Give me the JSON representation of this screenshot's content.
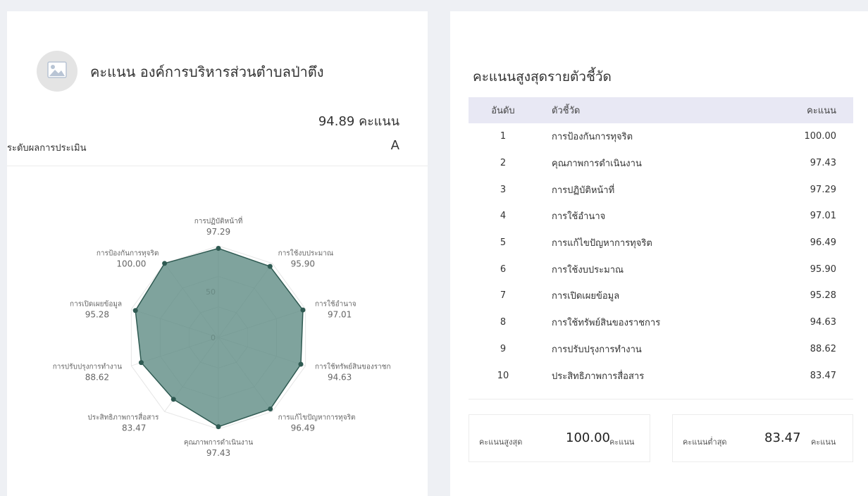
{
  "summary": {
    "title": "คะแนน องค์การบริหารส่วนตำบลป่าตึง",
    "score": "94.89",
    "score_unit": "คะแนน",
    "level_label": "ระดับผลการประเมิน",
    "level_value": "A"
  },
  "chart_data": {
    "type": "radar",
    "scale_ticks": [
      "0",
      "50"
    ],
    "rmax": 100,
    "fill_color": "#5f8c84",
    "axes": [
      {
        "label": "การปฏิบัติหน้าที่",
        "value": 97.29,
        "value_label": "97.29"
      },
      {
        "label": "การใช้งบประมาณ",
        "value": 95.9,
        "value_label": "95.90"
      },
      {
        "label": "การใช้อำนาจ",
        "value": 97.01,
        "value_label": "97.01"
      },
      {
        "label": "การใช้ทรัพย์สินของราชก",
        "value": 94.63,
        "value_label": "94.63"
      },
      {
        "label": "การแก้ไขปัญหาการทุจริต",
        "value": 96.49,
        "value_label": "96.49"
      },
      {
        "label": "คุณภาพการดำเนินงาน",
        "value": 97.43,
        "value_label": "97.43"
      },
      {
        "label": "ประสิทธิภาพการสื่อสาร",
        "value": 83.47,
        "value_label": "83.47"
      },
      {
        "label": "การปรับปรุงการทำงาน",
        "value": 88.62,
        "value_label": "88.62"
      },
      {
        "label": "การเปิดเผยข้อมูล",
        "value": 95.28,
        "value_label": "95.28"
      },
      {
        "label": "การป้องกันการทุจริต",
        "value": 100.0,
        "value_label": "100.00"
      }
    ]
  },
  "ranking": {
    "title": "คะแนนสูงสุดรายตัวชี้วัด",
    "headers": {
      "rank": "อันดับ",
      "indicator": "ตัวชี้วัด",
      "score": "คะแนน"
    },
    "rows": [
      {
        "rank": "1",
        "indicator": "การป้องกันการทุจริต",
        "score": "100.00"
      },
      {
        "rank": "2",
        "indicator": "คุณภาพการดำเนินงาน",
        "score": "97.43"
      },
      {
        "rank": "3",
        "indicator": "การปฏิบัติหน้าที่",
        "score": "97.29"
      },
      {
        "rank": "4",
        "indicator": "การใช้อำนาจ",
        "score": "97.01"
      },
      {
        "rank": "5",
        "indicator": "การแก้ไขปัญหาการทุจริต",
        "score": "96.49"
      },
      {
        "rank": "6",
        "indicator": "การใช้งบประมาณ",
        "score": "95.90"
      },
      {
        "rank": "7",
        "indicator": "การเปิดเผยข้อมูล",
        "score": "95.28"
      },
      {
        "rank": "8",
        "indicator": "การใช้ทรัพย์สินของราชการ",
        "score": "94.63"
      },
      {
        "rank": "9",
        "indicator": "การปรับปรุงการทำงาน",
        "score": "88.62"
      },
      {
        "rank": "10",
        "indicator": "ประสิทธิภาพการสื่อสาร",
        "score": "83.47"
      }
    ]
  },
  "stats": {
    "max_label": "คะแนนสูงสุด",
    "max_value": "100.00",
    "min_label": "คะแนนต่ำสุด",
    "min_value": "83.47",
    "unit": "คะแนน"
  }
}
